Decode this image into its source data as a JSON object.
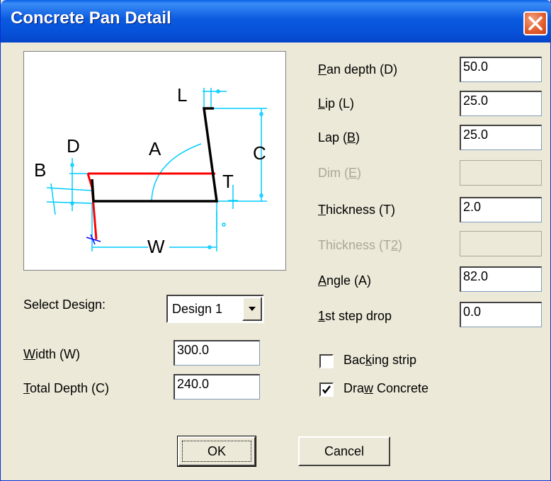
{
  "window": {
    "title": "Concrete Pan Detail"
  },
  "preview": {
    "labels": {
      "L": "L",
      "D": "D",
      "A": "A",
      "C": "C",
      "B": "B",
      "T": "T",
      "W": "W"
    },
    "colors": {
      "outline": "#000000",
      "red": "#ff0000",
      "dim": "#00ccff",
      "marker": "#0000ff"
    }
  },
  "fields": {
    "pan_depth": {
      "label": "Pan depth (D)",
      "value": "50.0"
    },
    "lip": {
      "label": "Lip (L)",
      "value": "25.0"
    },
    "lap": {
      "label": "Lap (B)",
      "value": "25.0"
    },
    "dim": {
      "label": "Dim (E)",
      "value": ""
    },
    "thickness": {
      "label": "Thickness (T)",
      "value": "2.0"
    },
    "thickness2": {
      "label": "Thickness (T2)",
      "value": ""
    },
    "angle": {
      "label": "Angle (A)",
      "value": "82.0"
    },
    "step_drop": {
      "label": "1st step drop",
      "value": "0.0"
    },
    "width": {
      "label": "Width (W)",
      "value": "300.0"
    },
    "total_depth": {
      "label": "Total Depth (C)",
      "value": "240.0"
    }
  },
  "design": {
    "label": "Select Design:",
    "selected": "Design 1"
  },
  "checkboxes": {
    "backing_strip": {
      "label": "Backing strip",
      "checked": false
    },
    "draw_concrete": {
      "label": "Draw Concrete",
      "checked": true
    }
  },
  "buttons": {
    "ok": "OK",
    "cancel": "Cancel"
  }
}
